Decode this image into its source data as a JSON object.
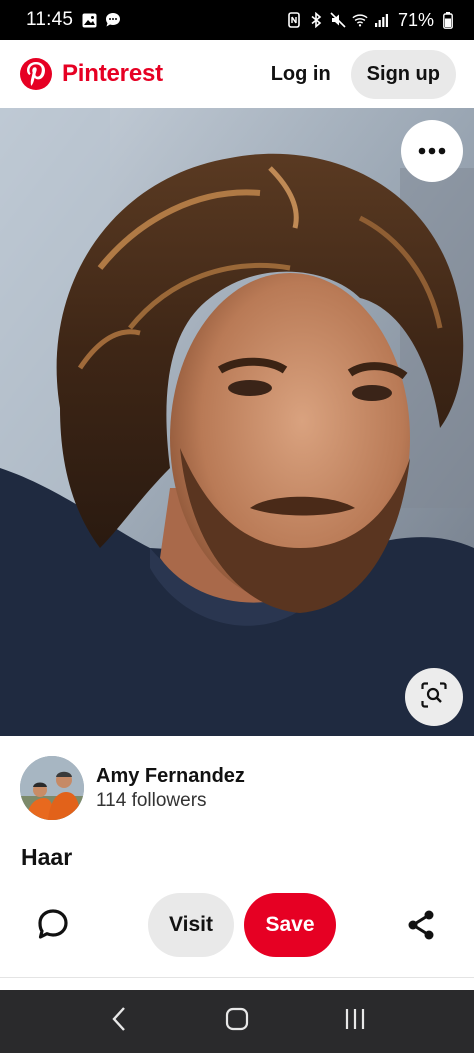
{
  "status_bar": {
    "time": "11:45",
    "battery": "71%",
    "left_icons": [
      "gallery-icon",
      "chat-bubble-icon"
    ],
    "right_icons": [
      "nfc-icon",
      "bluetooth-icon",
      "mute-icon",
      "wifi-icon",
      "signal-icon",
      "battery-icon"
    ]
  },
  "header": {
    "brand": "Pinterest",
    "login_label": "Log in",
    "signup_label": "Sign up"
  },
  "pin": {
    "more_icon": "more-dots-icon",
    "lens_icon": "visual-search-icon"
  },
  "creator": {
    "name": "Amy Fernandez",
    "followers": "114 followers"
  },
  "title": "Haar",
  "actions": {
    "visit_label": "Visit",
    "save_label": "Save",
    "comment_icon": "comment-icon",
    "share_icon": "share-icon"
  },
  "nav": {
    "icons": [
      "back-icon",
      "home-icon",
      "recent-apps-icon"
    ]
  },
  "colors": {
    "brand": "#e60023",
    "button_gray": "#e9e9e9",
    "nav_bar": "#2a2a2c"
  }
}
